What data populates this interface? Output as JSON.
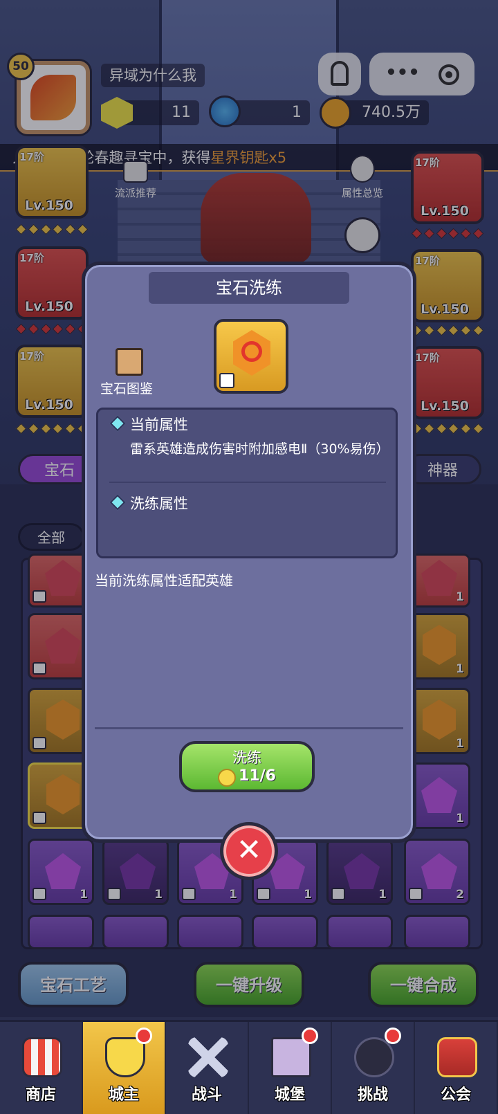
{
  "player": {
    "level": "50",
    "name": "异域为什么我",
    "diamonds": "11",
    "potions": "1",
    "gold": "740.5万"
  },
  "ticker": {
    "prefix": "人，在第1轮春趣寻宝中，获得",
    "highlight": "星界钥匙x5"
  },
  "side_buttons": {
    "build_recommend": "流派推荐",
    "attr_overview": "属性总览"
  },
  "left_equipment": [
    {
      "tier": "17阶",
      "level": "Lv.150"
    },
    {
      "tier": "17阶",
      "level": "Lv.150"
    },
    {
      "tier": "17阶",
      "level": "Lv.150"
    }
  ],
  "right_equipment": [
    {
      "tier": "17阶",
      "level": "Lv.150"
    },
    {
      "tier": "17阶",
      "level": "Lv.150"
    },
    {
      "tier": "17阶",
      "level": "Lv.150"
    }
  ],
  "tabs": {
    "gem": "宝石",
    "artifact": "神器",
    "filter_all": "全部"
  },
  "grid_counts": {
    "row1_right": "1",
    "row2_right": "1",
    "row3_right": "1",
    "row4_right": "1",
    "row5": [
      "1",
      "1",
      "1",
      "1",
      "1",
      "2"
    ]
  },
  "modal": {
    "title": "宝石洗练",
    "codex_label": "宝石图鉴",
    "current_attr_heading": "当前属性",
    "current_attr_text": "雷系英雄造成伤害时附加感电Ⅱ（30%易伤）",
    "refine_attr_heading": "洗练属性",
    "hint": "当前洗练属性适配英雄",
    "refine_button": "洗练",
    "refine_cost": "11/6"
  },
  "bottom_buttons": {
    "gem_craft": "宝石工艺",
    "one_click_upgrade": "一键升级",
    "one_click_merge": "一键合成"
  },
  "nav": [
    {
      "label": "商店",
      "icon": "shop-icon"
    },
    {
      "label": "城主",
      "icon": "lord-icon"
    },
    {
      "label": "战斗",
      "icon": "battle-icon"
    },
    {
      "label": "城堡",
      "icon": "castle-icon"
    },
    {
      "label": "挑战",
      "icon": "challenge-icon"
    },
    {
      "label": "公会",
      "icon": "guild-icon"
    }
  ],
  "colors": {
    "accent_gold": "#f2c64a",
    "highlight_orange": "#f3a23a",
    "confirm_green": "#5cb832",
    "close_red": "#e6404a"
  }
}
